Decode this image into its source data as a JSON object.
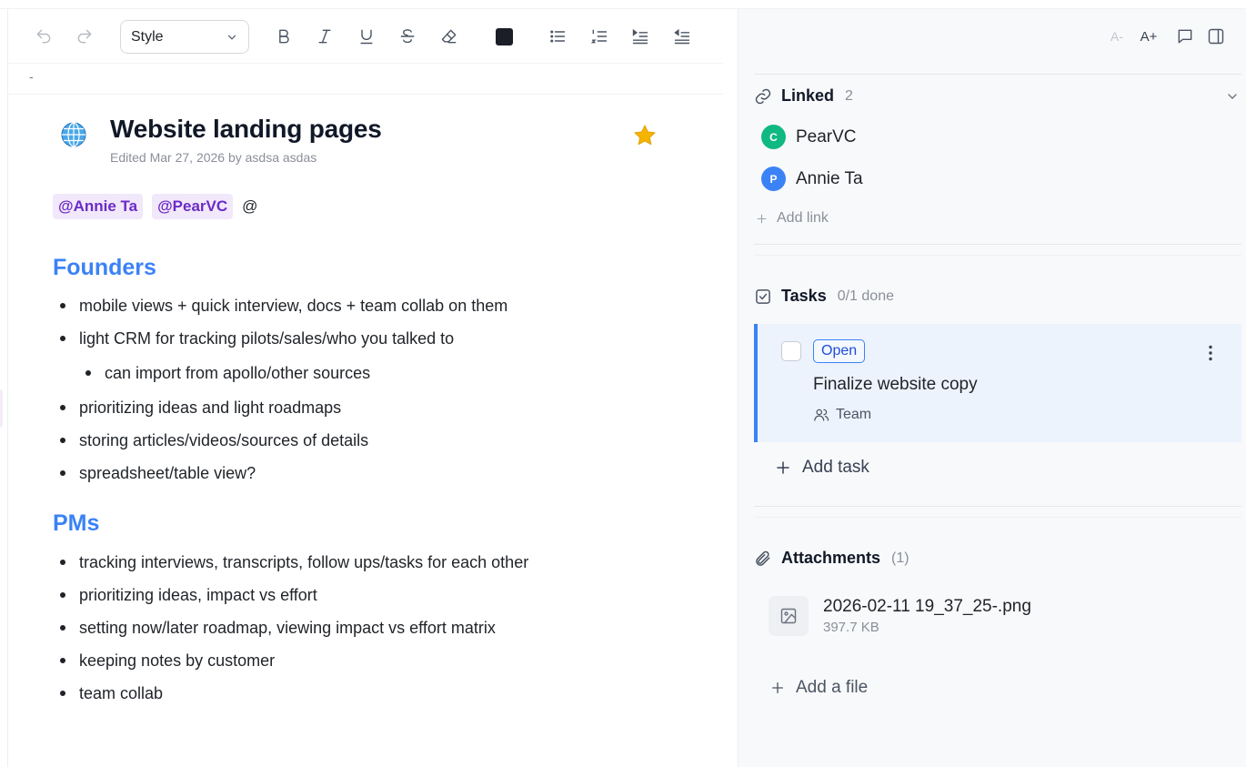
{
  "toolbar": {
    "style_label": "Style",
    "text_color": "#1b1e26"
  },
  "doc": {
    "separator": "-",
    "icon": "globe-icon",
    "title": "Website landing pages",
    "edited": "Edited Mar 27, 2026 by asdsa asdas",
    "mentions": [
      "@Annie Ta",
      "@PearVC"
    ],
    "mention_prompt": "@",
    "sections": [
      {
        "heading": "Founders",
        "items": [
          {
            "text": "mobile views + quick interview, docs + team collab on them",
            "level": 0
          },
          {
            "text": "light CRM for tracking pilots/sales/who you talked to",
            "level": 0
          },
          {
            "text": "can import from apollo/other sources",
            "level": 1
          },
          {
            "text": "prioritizing ideas and light roadmaps",
            "level": 0
          },
          {
            "text": "storing articles/videos/sources of details",
            "level": 0
          },
          {
            "text": "spreadsheet/table view?",
            "level": 0
          }
        ]
      },
      {
        "heading": "PMs",
        "items": [
          {
            "text": "tracking interviews, transcripts, follow ups/tasks for each other",
            "level": 0
          },
          {
            "text": "prioritizing ideas, impact vs effort",
            "level": 0
          },
          {
            "text": "setting now/later roadmap, viewing impact vs effort matrix",
            "level": 0
          },
          {
            "text": "keeping notes by customer",
            "level": 0
          },
          {
            "text": "team collab",
            "level": 0
          }
        ]
      }
    ]
  },
  "side": {
    "font_down": "A-",
    "font_up": "A+",
    "linked": {
      "title": "Linked",
      "count": "2",
      "items": [
        {
          "initial": "C",
          "name": "PearVC",
          "color": "#10b981"
        },
        {
          "initial": "P",
          "name": "Annie Ta",
          "color": "#3b82f6"
        }
      ],
      "add_label": "Add link"
    },
    "tasks": {
      "title": "Tasks",
      "count": "0/1 done",
      "task": {
        "status": "Open",
        "title": "Finalize website copy",
        "assignee": "Team"
      },
      "add_label": "Add task"
    },
    "attachments": {
      "title": "Attachments",
      "count": "(1)",
      "file": {
        "name": "2026-02-11 19_37_25-.png",
        "size": "397.7 KB"
      },
      "add_label": "Add a file"
    }
  },
  "colors": {
    "accent": "#3b82f6",
    "mention_bg": "#f1e8fc",
    "mention_text": "#6b2bc4",
    "star": "#f5b400"
  }
}
